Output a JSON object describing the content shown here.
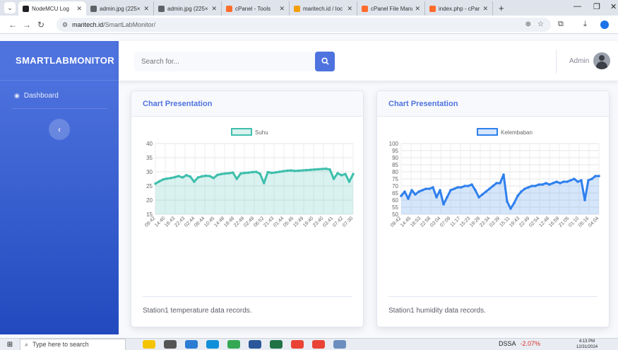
{
  "browser": {
    "tabs": [
      {
        "title": "NodeMCU Log",
        "icon": "home-icon",
        "color": "#202124",
        "active": true
      },
      {
        "title": "admin.jpg (225×",
        "icon": "globe-icon",
        "color": "#5f6368"
      },
      {
        "title": "admin.jpg (225×",
        "icon": "globe-icon",
        "color": "#5f6368"
      },
      {
        "title": "cPanel - Tools",
        "icon": "cpanel-icon",
        "color": "#ff6c2c"
      },
      {
        "title": "maritech.id / loc",
        "icon": "phpmyadmin-icon",
        "color": "#f59e0b"
      },
      {
        "title": "cPanel File Mana",
        "icon": "cpanel-icon",
        "color": "#ff6c2c"
      },
      {
        "title": "index.php - cPar",
        "icon": "cpanel-icon",
        "color": "#ff6c2c"
      }
    ],
    "url_host": "maritech.id",
    "url_path": "/SmartLabMonitor/"
  },
  "sidebar": {
    "brand": "SMARTLABMONITOR",
    "items": [
      {
        "label": "Dashboard",
        "icon": "tachometer-icon"
      }
    ],
    "toggle_icon": "chevron-left-icon"
  },
  "topbar": {
    "search_placeholder": "Search for...",
    "search_icon": "search-icon",
    "user_name": "Admin"
  },
  "cards": [
    {
      "header": "Chart Presentation",
      "footer": "Station1 temperature data records."
    },
    {
      "header": "Chart Presentation",
      "footer": "Station1 humidity data records."
    }
  ],
  "chart_data": [
    {
      "type": "line",
      "legend": "Suhu",
      "legend_position": "top",
      "ylim": [
        15,
        40
      ],
      "yticks": [
        15,
        20,
        25,
        30,
        35,
        40
      ],
      "xticks": [
        "09:42",
        "14:40",
        "18:43",
        "22:43",
        "02:44",
        "06:44",
        "10:45",
        "14:48",
        "18:48",
        "22:49",
        "02:49",
        "06:52",
        "21:43",
        "01:44",
        "05:45",
        "15:49",
        "19:40",
        "23:40",
        "03:41",
        "07:42",
        "07:30"
      ],
      "color": "#3fbfad",
      "fill": "rgba(63,191,173,0.2)",
      "grid": true,
      "series": [
        {
          "name": "Suhu",
          "values": [
            25.8,
            26.6,
            27.3,
            27.6,
            27.8,
            28.1,
            28.5,
            28.0,
            28.8,
            28.3,
            26.5,
            28.0,
            28.4,
            28.6,
            28.5,
            27.8,
            28.9,
            29.2,
            29.4,
            29.5,
            29.7,
            27.5,
            29.4,
            29.6,
            29.7,
            29.9,
            30.0,
            29.3,
            26.0,
            29.9,
            29.6,
            29.8,
            30.0,
            30.2,
            30.4,
            30.5,
            30.3,
            30.4,
            30.5,
            30.6,
            30.7,
            30.8,
            30.9,
            31.0,
            31.1,
            30.8,
            27.5,
            29.5,
            28.8,
            29.2,
            26.5,
            29.2
          ]
        }
      ]
    },
    {
      "type": "line",
      "legend": "Kelembaban",
      "legend_position": "top",
      "ylim": [
        50,
        100
      ],
      "yticks": [
        50,
        55,
        60,
        65,
        70,
        75,
        80,
        85,
        90,
        95,
        100
      ],
      "xticks": [
        "09:42",
        "14:45",
        "18:53",
        "22:58",
        "03:04",
        "07:09",
        "11:17",
        "15:23",
        "19:28",
        "23:34",
        "03:39",
        "15:11",
        "19:43",
        "22:49",
        "02:54",
        "12:48",
        "16:59",
        "21:05",
        "01:10",
        "05:16",
        "04:04"
      ],
      "color": "#2f80ed",
      "fill": "rgba(47,128,237,0.2)",
      "grid": true,
      "series": [
        {
          "name": "Kelembaban",
          "values": [
            63,
            66,
            61,
            67,
            64,
            66,
            67,
            68,
            68,
            69,
            62,
            67,
            57,
            62,
            67,
            68,
            69,
            69,
            70,
            70,
            71,
            67,
            62,
            64,
            66,
            68,
            70,
            72,
            72,
            78,
            59,
            54,
            58,
            63,
            66,
            68,
            69,
            70,
            70,
            71,
            71,
            72,
            71,
            72,
            73,
            72,
            73,
            73,
            74,
            75,
            73,
            74,
            60,
            74,
            75,
            77,
            77
          ]
        }
      ]
    }
  ],
  "taskbar": {
    "search_placeholder": "Type here to search",
    "stock_name": "DSSA",
    "stock_change": "-2.07%",
    "time": "4:13 PM",
    "date": "12/31/2024",
    "apps": [
      "cortana-icon",
      "task-view-icon",
      "file-explorer-icon",
      "edge-icon",
      "chrome-icon",
      "word-icon",
      "excel-icon",
      "chrome-icon",
      "chrome-icon",
      "misc-app-icon"
    ]
  }
}
